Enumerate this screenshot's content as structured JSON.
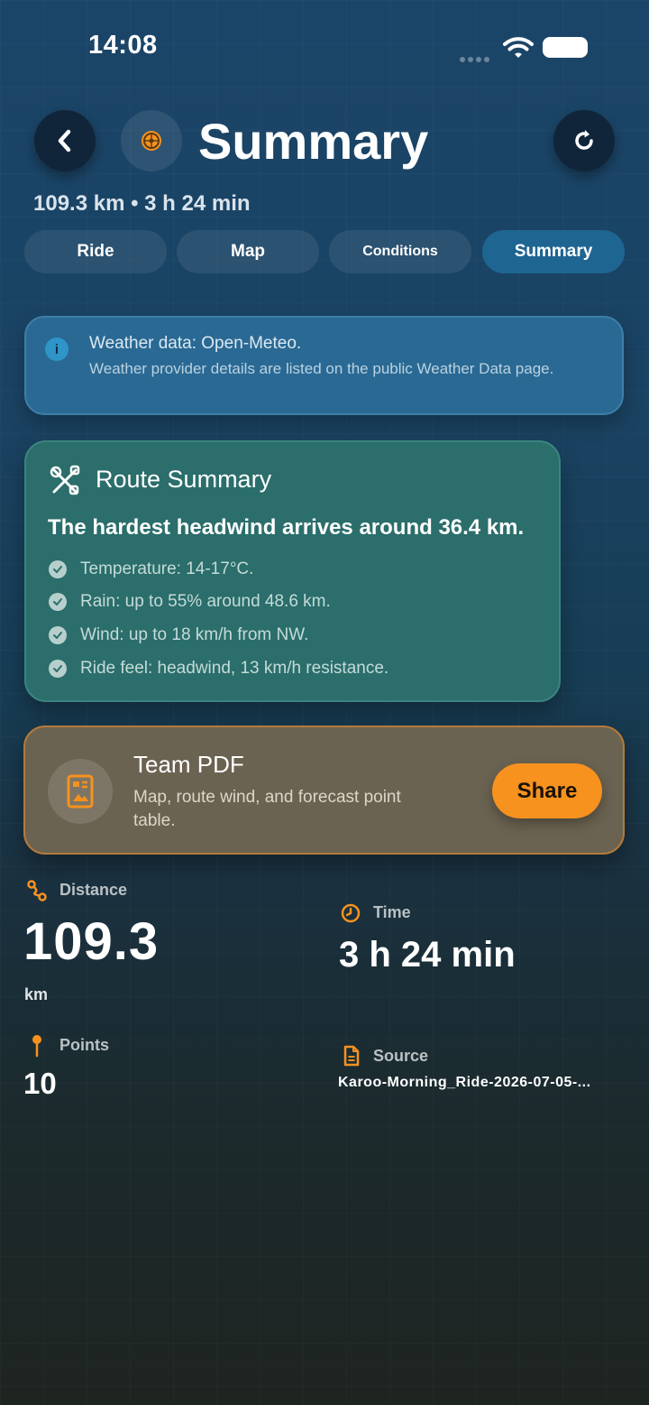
{
  "status_bar": {
    "time": "14:08"
  },
  "header": {
    "title": "Summary",
    "subtitle": "109.3 km • 3 h 24 min"
  },
  "tabs": [
    {
      "label": "Ride",
      "active": false
    },
    {
      "label": "Map",
      "active": false
    },
    {
      "label": "Conditions",
      "active": false
    },
    {
      "label": "Summary",
      "active": true
    }
  ],
  "info_banner": {
    "title": "Weather data: Open-Meteo.",
    "text": "Weather provider details are listed on the public Weather Data page."
  },
  "route_summary": {
    "title": "Route Summary",
    "headline": "The hardest headwind arrives around 36.4 km.",
    "bullets": [
      "Temperature: 14-17°C.",
      "Rain: up to 55% around 48.6 km.",
      "Wind: up to 18 km/h from NW.",
      "Ride feel: headwind, 13 km/h resistance."
    ]
  },
  "team_pdf": {
    "title": "Team PDF",
    "text": "Map, route wind, and forecast point table.",
    "share_label": "Share"
  },
  "stats": {
    "distance": {
      "label": "Distance",
      "value": "109.3",
      "unit": "km"
    },
    "time": {
      "label": "Time",
      "value": "3 h 24 min"
    },
    "points": {
      "label": "Points",
      "value": "10"
    },
    "source": {
      "label": "Source",
      "value": "Karoo-Morning_Ride-2026-07-05-..."
    }
  },
  "colors": {
    "accent_orange": "#f7921f",
    "tab_active": "#1f6592",
    "info_blue": "#2a6993",
    "route_green": "#2b6e6b"
  },
  "icons": {
    "back": "chevron-left-icon",
    "logo": "wheel-icon",
    "refresh": "refresh-icon",
    "info": "info-icon",
    "route": "tools-icon",
    "pdf": "document-icon",
    "distance": "route-icon",
    "time": "clock-icon",
    "points": "pin-icon",
    "source": "file-icon"
  }
}
